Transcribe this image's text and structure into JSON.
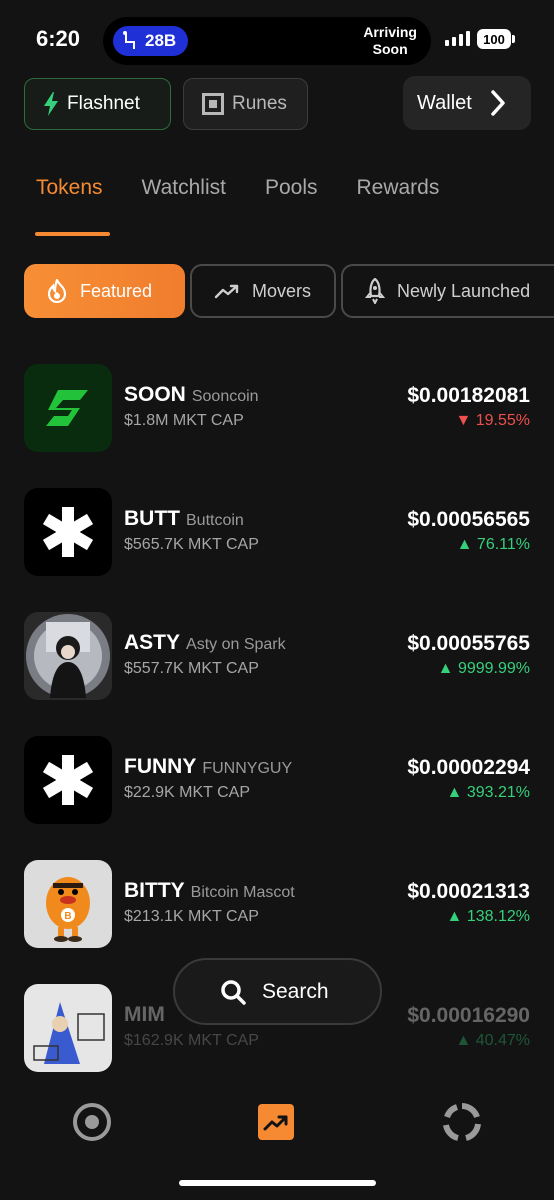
{
  "status_bar": {
    "time": "6:20",
    "seat": "28B",
    "arriving_line1": "Arriving",
    "arriving_line2": "Soon",
    "battery": "100"
  },
  "top_chips": {
    "flashnet": "Flashnet",
    "runes": "Runes",
    "wallet": "Wallet"
  },
  "tabs": [
    {
      "label": "Tokens",
      "active": true
    },
    {
      "label": "Watchlist",
      "active": false
    },
    {
      "label": "Pools",
      "active": false
    },
    {
      "label": "Rewards",
      "active": false
    }
  ],
  "filters": [
    {
      "label": "Featured",
      "icon": "fire-icon",
      "active": true
    },
    {
      "label": "Movers",
      "icon": "trending-up-icon",
      "active": false
    },
    {
      "label": "Newly Launched",
      "icon": "rocket-icon",
      "active": false
    }
  ],
  "tokens": [
    {
      "symbol": "SOON",
      "name": "Sooncoin",
      "mcap": "$1.8M MKT CAP",
      "price": "$0.00182081",
      "change": "▼ 19.55%",
      "direction": "down"
    },
    {
      "symbol": "BUTT",
      "name": "Buttcoin",
      "mcap": "$565.7K MKT CAP",
      "price": "$0.00056565",
      "change": "▲ 76.11%",
      "direction": "up"
    },
    {
      "symbol": "ASTY",
      "name": "Asty on Spark",
      "mcap": "$557.7K MKT CAP",
      "price": "$0.00055765",
      "change": "▲ 9999.99%",
      "direction": "up"
    },
    {
      "symbol": "FUNNY",
      "name": "FUNNYGUY",
      "mcap": "$22.9K MKT CAP",
      "price": "$0.00002294",
      "change": "▲ 393.21%",
      "direction": "up"
    },
    {
      "symbol": "BITTY",
      "name": "Bitcoin Mascot",
      "mcap": "$213.1K MKT CAP",
      "price": "$0.00021313",
      "change": "▲ 138.12%",
      "direction": "up"
    },
    {
      "symbol": "MIM",
      "name": "",
      "mcap": "$162.9K MKT CAP",
      "price": "$0.00016290",
      "change": "▲ 40.47%",
      "direction": "up"
    }
  ],
  "search": {
    "label": "Search"
  },
  "colors": {
    "accent": "#f58a32",
    "up": "#35d07b",
    "down": "#ef4f4f",
    "background": "#131313"
  }
}
